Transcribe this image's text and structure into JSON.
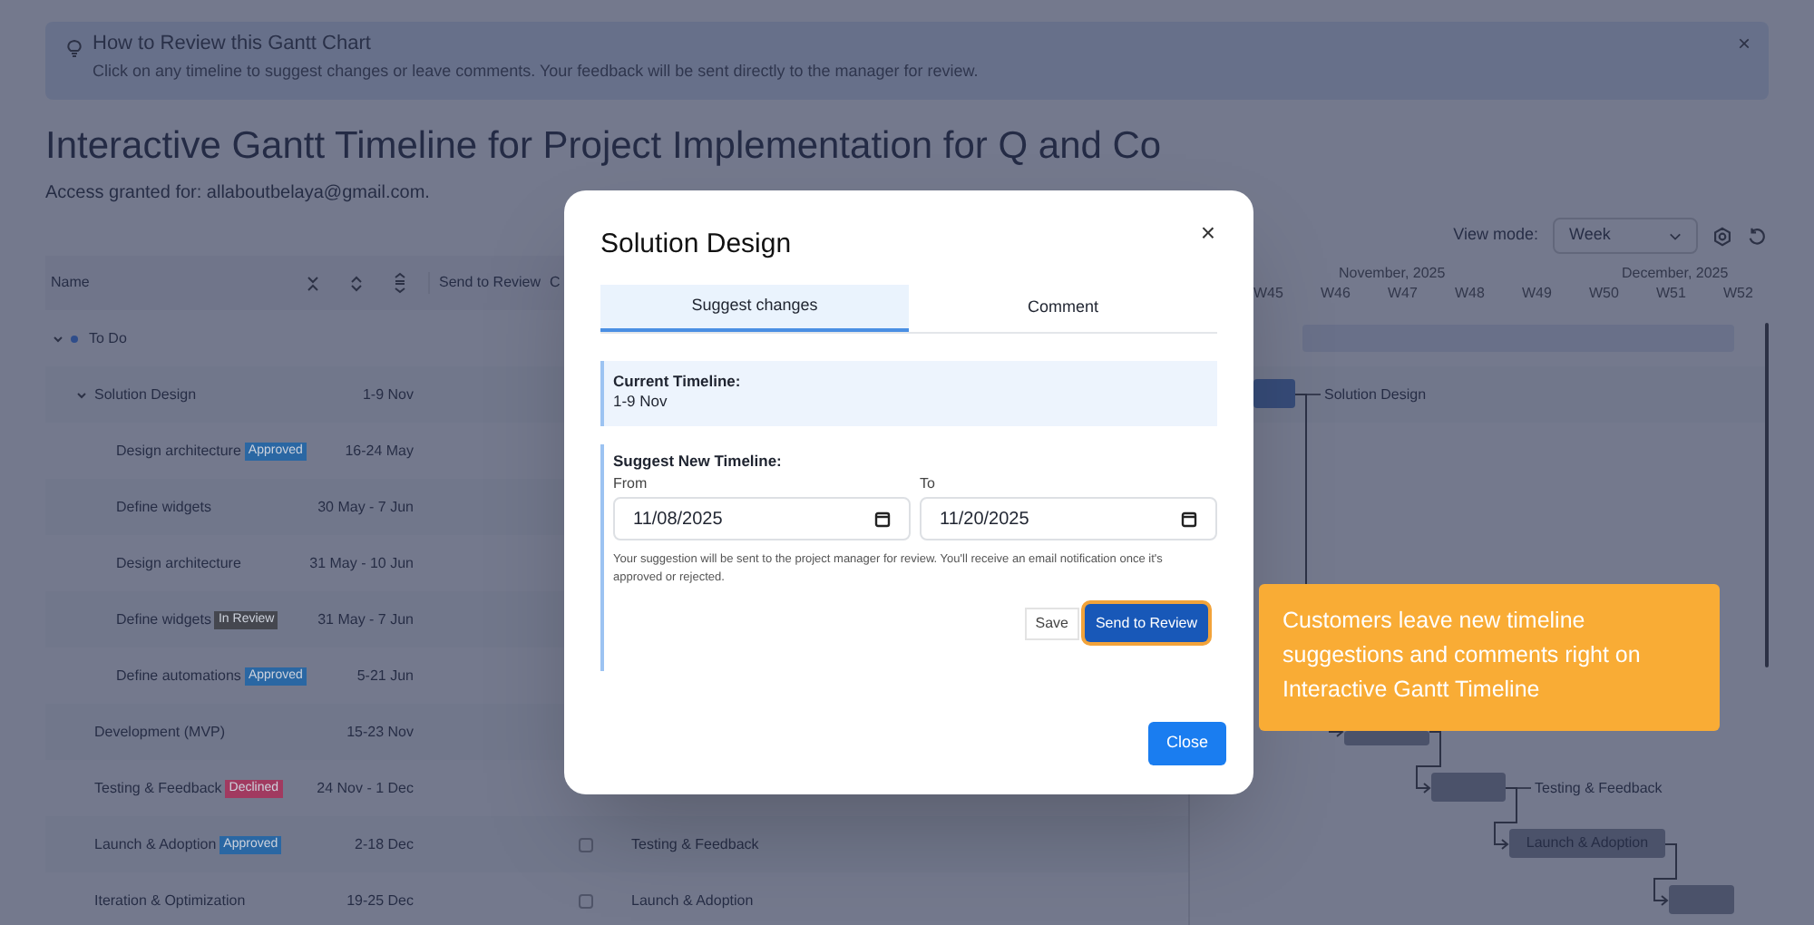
{
  "banner": {
    "title": "How to Review this Gantt Chart",
    "text": "Click on any timeline to suggest changes or leave comments. Your feedback will be sent directly to the manager for review.",
    "close": "×"
  },
  "title": "Interactive Gantt Timeline for Project Implementation for Q and Co",
  "access": "Access granted for: allaboutbelaya@gmail.com.",
  "view_mode": {
    "label": "View mode:",
    "value": "Week"
  },
  "table": {
    "columns": [
      "Name",
      "Send to Review",
      "C"
    ],
    "rows": [
      {
        "name": "To Do",
        "expanded": true,
        "children": [
          {
            "name": "Solution Design",
            "dates": "1-9 Nov",
            "expanded": true,
            "children": [
              {
                "name": "Design architecture",
                "badge": {
                  "text": "Approved",
                  "color": "#2a67a3"
                },
                "dates": "16-24 May"
              },
              {
                "name": "Define widgets",
                "dates": "30 May - 7 Jun"
              },
              {
                "name": "Design architecture",
                "dates": "31 May - 10 Jun"
              },
              {
                "name": "Define widgets",
                "badge": {
                  "text": "In Review",
                  "color": "#45474f"
                },
                "dates": "31 May - 7 Jun"
              },
              {
                "name": "Define automations",
                "badge": {
                  "text": "Approved",
                  "color": "#2a67a3"
                },
                "dates": "5-21 Jun"
              }
            ]
          },
          {
            "name": "Development (MVP)",
            "dates": "15-23 Nov"
          },
          {
            "name": "Testing & Feedback",
            "badge": {
              "text": "Declined",
              "color": "#a13a60"
            },
            "dates": "24 Nov - 1 Dec"
          },
          {
            "name": "Launch & Adoption",
            "badge": {
              "text": "Approved",
              "color": "#2a67a3"
            },
            "dates": "2-18 Dec",
            "checked": false,
            "dependency": "Testing & Feedback"
          },
          {
            "name": "Iteration & Optimization",
            "dates": "19-25 Dec",
            "checked": false,
            "dependency": "Launch & Adoption"
          }
        ]
      }
    ]
  },
  "gantt": {
    "months": [
      {
        "label": "November, 2025"
      },
      {
        "label": "December, 2025"
      }
    ],
    "weeks": [
      "W45",
      "W46",
      "W47",
      "W48",
      "W49",
      "W50",
      "W51",
      "W52"
    ],
    "bars": [
      {
        "kind": "summary"
      },
      {
        "kind": "task",
        "label": "Solution Design"
      },
      {
        "kind": "task"
      },
      {
        "kind": "task",
        "label": "Testing & Feedback"
      },
      {
        "kind": "task",
        "inner_label": "Launch & Adoption"
      },
      {
        "kind": "task"
      }
    ]
  },
  "modal": {
    "title": "Solution Design",
    "close": "×",
    "tabs": [
      {
        "label": "Suggest changes",
        "selected": true
      },
      {
        "label": "Comment",
        "selected": false
      }
    ],
    "current": {
      "label": "Current Timeline:",
      "value": "1-9 Nov"
    },
    "suggest": {
      "label": "Suggest New Timeline:",
      "from_label": "From",
      "from_value": "11/08/2025",
      "to_label": "To",
      "to_value": "11/20/2025",
      "note": "Your suggestion will be sent to the project manager for review. You'll receive an email notification once it's approved or rejected."
    },
    "buttons": {
      "save": "Save",
      "send": "Send to Review",
      "close": "Close"
    }
  },
  "callout": "Customers leave new timeline suggestions and comments right on Interactive Gantt Timeline"
}
